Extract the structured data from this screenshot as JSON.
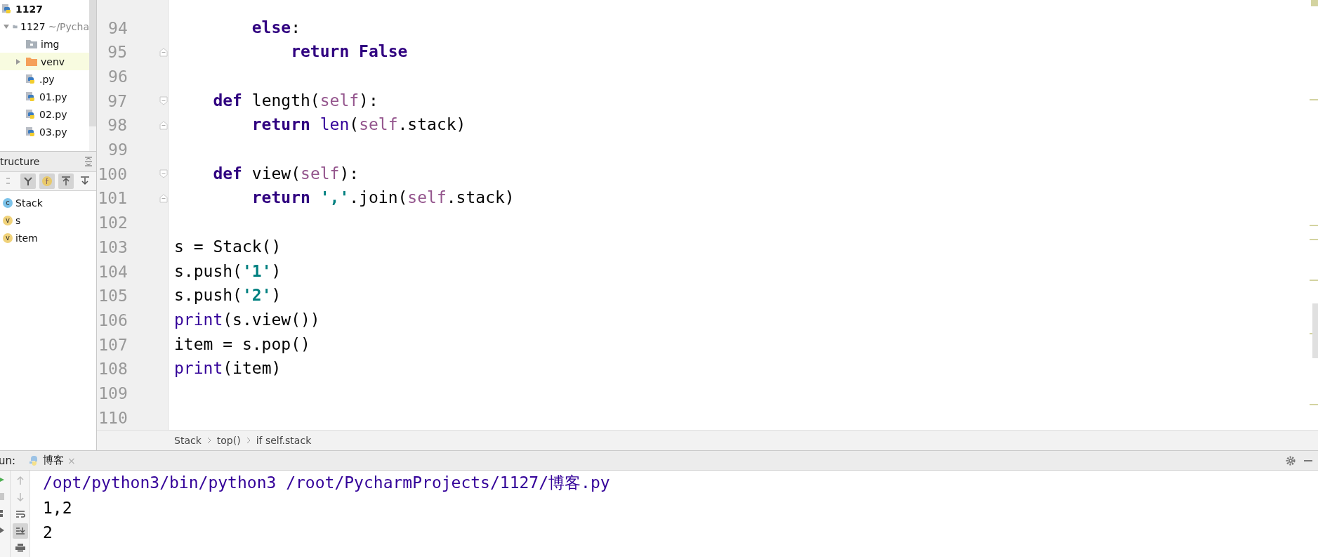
{
  "project_tree": {
    "root": "1127",
    "items": [
      {
        "name": "1127",
        "hint": "~/Pycha",
        "kind": "folder",
        "expanded": true,
        "selected": false,
        "children": [
          {
            "name": "img",
            "kind": "resource-folder",
            "selected": false
          },
          {
            "name": "venv",
            "kind": "excluded-folder",
            "expanded": false,
            "selected": true
          },
          {
            "name": ".py",
            "kind": "python",
            "selected": false
          },
          {
            "name": "01.py",
            "kind": "python",
            "selected": false
          },
          {
            "name": "02.py",
            "kind": "python",
            "selected": false
          },
          {
            "name": "03.py",
            "kind": "python",
            "selected": false
          }
        ]
      }
    ]
  },
  "structure": {
    "title": "tructure",
    "items": [
      {
        "name": "Stack",
        "badge": "c",
        "color": "#7cc3ea"
      },
      {
        "name": "s",
        "badge": "v",
        "color": "#f0d27a"
      },
      {
        "name": "item",
        "badge": "v",
        "color": "#f0d27a"
      }
    ]
  },
  "editor": {
    "lines": [
      {
        "number": "94",
        "fold_start": false,
        "fold_end": false,
        "tokens": [
          {
            "kind": "kw",
            "text": "        else"
          },
          {
            "kind": "text",
            "text": ":"
          }
        ]
      },
      {
        "number": "95",
        "fold_start": false,
        "fold_end": true,
        "tokens": [
          {
            "kind": "kw",
            "text": "            return"
          },
          {
            "kind": "kw",
            "text": " False"
          }
        ]
      },
      {
        "number": "96",
        "fold_start": false,
        "fold_end": false
      },
      {
        "number": "97",
        "fold_start": true,
        "fold_end": false,
        "tokens": [
          {
            "kind": "kw",
            "text": "    def"
          },
          {
            "kind": "text",
            "text": " length("
          },
          {
            "kind": "self",
            "text": "self"
          },
          {
            "kind": "text",
            "text": "):"
          }
        ]
      },
      {
        "number": "98",
        "fold_start": false,
        "fold_end": true,
        "tokens": [
          {
            "kind": "kw",
            "text": "        return"
          },
          {
            "kind": "builtin",
            "text": " len"
          },
          {
            "kind": "text",
            "text": "("
          },
          {
            "kind": "self",
            "text": "self"
          },
          {
            "kind": "text",
            "text": ".stack)"
          }
        ]
      },
      {
        "number": "99",
        "fold_start": false,
        "fold_end": false
      },
      {
        "number": "100",
        "fold_start": true,
        "fold_end": false,
        "tokens": [
          {
            "kind": "kw",
            "text": "    def"
          },
          {
            "kind": "text",
            "text": " view("
          },
          {
            "kind": "self",
            "text": "self"
          },
          {
            "kind": "text",
            "text": "):"
          }
        ]
      },
      {
        "number": "101",
        "fold_start": false,
        "fold_end": true,
        "tokens": [
          {
            "kind": "kw",
            "text": "        return"
          },
          {
            "kind": "str",
            "text": " ','"
          },
          {
            "kind": "text",
            "text": ".join("
          },
          {
            "kind": "self",
            "text": "self"
          },
          {
            "kind": "text",
            "text": ".stack)"
          }
        ]
      },
      {
        "number": "102",
        "fold_start": false,
        "fold_end": false
      },
      {
        "number": "103",
        "fold_start": false,
        "fold_end": false,
        "tokens": [
          {
            "kind": "text",
            "text": "s = Stack()"
          }
        ]
      },
      {
        "number": "104",
        "fold_start": false,
        "fold_end": false,
        "tokens": [
          {
            "kind": "text",
            "text": "s.push("
          },
          {
            "kind": "str",
            "text": "'1'"
          },
          {
            "kind": "text",
            "text": ")"
          }
        ]
      },
      {
        "number": "105",
        "fold_start": false,
        "fold_end": false,
        "tokens": [
          {
            "kind": "text",
            "text": "s.push("
          },
          {
            "kind": "str",
            "text": "'2'"
          },
          {
            "kind": "text",
            "text": ")"
          }
        ]
      },
      {
        "number": "106",
        "fold_start": false,
        "fold_end": false,
        "tokens": [
          {
            "kind": "builtin",
            "text": "print"
          },
          {
            "kind": "text",
            "text": "(s.view())"
          }
        ]
      },
      {
        "number": "107",
        "fold_start": false,
        "fold_end": false,
        "tokens": [
          {
            "kind": "text",
            "text": "item = s.pop()"
          }
        ]
      },
      {
        "number": "108",
        "fold_start": false,
        "fold_end": false,
        "tokens": [
          {
            "kind": "builtin",
            "text": "print"
          },
          {
            "kind": "text",
            "text": "(item)"
          }
        ]
      },
      {
        "number": "109",
        "fold_start": false,
        "fold_end": false
      },
      {
        "number": "110",
        "fold_start": false,
        "fold_end": false
      }
    ]
  },
  "breadcrumbs": [
    "Stack",
    "top()",
    "if self.stack"
  ],
  "run": {
    "label": "un:",
    "tabs": [
      {
        "title": "博客",
        "close": "×"
      }
    ],
    "console": [
      {
        "kind": "command",
        "text": "/opt/python3/bin/python3 /root/PycharmProjects/1127/博客.py"
      },
      {
        "kind": "output",
        "text": "1,2"
      },
      {
        "kind": "output",
        "text": "2"
      }
    ]
  }
}
